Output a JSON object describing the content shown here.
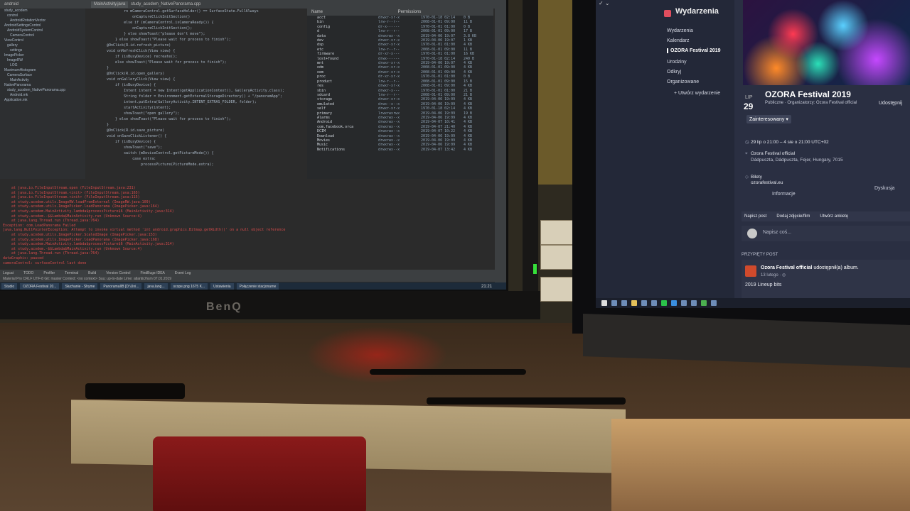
{
  "left_monitor": {
    "brand": "BenQ",
    "ide": {
      "tabs": [
        "android",
        "study_acodem_NativePanorama.cpp",
        "MainActivity.java"
      ],
      "tree": [
        "study_acodem",
        "control",
        "AndroidRotationVector",
        "AndroidSettingsControl",
        "AndroidSystemControl",
        "CameraControl",
        "ViewControl",
        "gallery",
        "settings",
        "ImagePicker",
        "ImageRW",
        "LOG",
        "MaximumHistogram",
        "CameraSurface",
        "MainActivity",
        "NativePanorama",
        "study_acodem_NativePanorama.cpp",
        "Android.mk",
        "Application.mk"
      ],
      "code": [
        "        rn mCameraControl.getSurfaceHolder() == SurfaceState.FullAlways",
        "            onCaptureClickInitSection()",
        "        else if (mCameraControl.isCameraReady()) {",
        "            onCaptureClickInitSection();",
        "        } else showToast(\"please don't move\");",
        "    } else showToast(\"Please wait for process to finish\");",
        "",
        "@OnClick(R.id.refresh_picture)",
        "void onRefreshClick(View view) {",
        "    if (isBusyDevice) recreate();",
        "    else showToast(\"Please wait for process to finish\");",
        "}",
        "",
        "@OnClick(R.id.open_gallery)",
        "void onGalleryClick(View view) {",
        "    if (isBusyDevice) {",
        "        Intent intent = new Intent(getApplicationContext(), GalleryActivity.class);",
        "        String folder = Environment.getExternalStorageDirectory() + \"/panoramApp\";",
        "        intent.putExtra(GalleryActivity.INTENT_EXTRAS_FOLDER, folder);",
        "        startActivity(intent);",
        "        showToast(\"open gallery\");",
        "    } else showToast(\"Please wait for process to finish\");",
        "}",
        "",
        "@OnClick(R.id.save_picture)",
        "void onSaveClickListener() {",
        "    if (isBusyDevice) {",
        "        showToast(\"save\");",
        "        switch (mDeviceControl.getPictureMode()) {",
        "            case extra:",
        "                processPicture(PictureMode.extra);"
      ],
      "files_header": {
        "name": "Name",
        "permissions": "Permissions"
      },
      "files": [
        {
          "name": "acct",
          "perm": "drwxr-xr-x",
          "date": "1970-01-18 02:14",
          "size": "0 B"
        },
        {
          "name": "bin",
          "perm": "lrw-r--r--",
          "date": "2008-01-01 09:00",
          "size": "11 B"
        },
        {
          "name": "config",
          "perm": "dr-x------",
          "date": "1970-01-01 01:00",
          "size": "0 B"
        },
        {
          "name": "d",
          "perm": "lrw-r--r--",
          "date": "2008-01-01 09:00",
          "size": "17 B"
        },
        {
          "name": "data",
          "perm": "drwxrwx--x",
          "date": "2019-04-06 19:07",
          "size": "3.8 KB"
        },
        {
          "name": "dev",
          "perm": "drwxr-xr-x",
          "date": "2019-04-06 19:07",
          "size": "1 KB"
        },
        {
          "name": "dsp",
          "perm": "drwxr-xr-x",
          "date": "1970-01-01 01:00",
          "size": "4 KB"
        },
        {
          "name": "etc",
          "perm": "lrw-r--r--",
          "date": "2008-01-01 09:00",
          "size": "11 B"
        },
        {
          "name": "firmware",
          "perm": "dr-xr-x---",
          "date": "1970-01-01 01:00",
          "size": "16 KB"
        },
        {
          "name": "lost+found",
          "perm": "drwx------",
          "date": "1970-01-18 02:14",
          "size": "240 B"
        },
        {
          "name": "mnt",
          "perm": "drwxr-xr-x",
          "date": "2019-04-06 19:07",
          "size": "4 KB"
        },
        {
          "name": "odm",
          "perm": "drwxr-xr-x",
          "date": "2008-01-01 09:00",
          "size": "4 KB"
        },
        {
          "name": "oem",
          "perm": "drwxr-xr-x",
          "date": "2008-01-01 09:00",
          "size": "4 KB"
        },
        {
          "name": "proc",
          "perm": "dr-xr-xr-x",
          "date": "1970-01-01 01:00",
          "size": "0 B"
        },
        {
          "name": "product",
          "perm": "lrw-r--r--",
          "date": "2008-01-01 09:00",
          "size": "15 B"
        },
        {
          "name": "res",
          "perm": "drwxr-xr-x",
          "date": "2008-01-01 09:00",
          "size": "4 KB"
        },
        {
          "name": "sbin",
          "perm": "drwxr-x---",
          "date": "1970-01-01 01:00",
          "size": "21 B"
        },
        {
          "name": "sdcard",
          "perm": "lrw-r--r--",
          "date": "2008-01-01 09:00",
          "size": "21 B"
        },
        {
          "name": "storage",
          "perm": "drwxr-xr-x",
          "date": "2019-04-06 19:09",
          "size": "4 KB"
        },
        {
          "name": "emulated",
          "perm": "drwx--x--x",
          "date": "2019-04-06 19:09",
          "size": "4 KB"
        },
        {
          "name": "self",
          "perm": "drwxr-xr-x",
          "date": "1970-01-18 02:14",
          "size": "4 KB"
        },
        {
          "name": "primary",
          "perm": "lrwxrwxrwx",
          "date": "2019-04-06 19:09",
          "size": "19 B"
        },
        {
          "name": "Alarms",
          "perm": "drwxrwx--x",
          "date": "2019-04-06 19:09",
          "size": "4 KB"
        },
        {
          "name": "Android",
          "perm": "drwxrwx--x",
          "date": "2019-04-07 10:41",
          "size": "4 KB"
        },
        {
          "name": "com.facebook.orca",
          "perm": "drwxrwx--x",
          "date": "2019-04-07 21:40",
          "size": "4 KB"
        },
        {
          "name": "DCIM",
          "perm": "drwxrwx--x",
          "date": "2019-04-07 10:22",
          "size": "4 KB"
        },
        {
          "name": "Download",
          "perm": "drwxrwx--x",
          "date": "2019-04-06 19:09",
          "size": "4 KB"
        },
        {
          "name": "Movies",
          "perm": "drwxrwx--x",
          "date": "2019-04-06 19:09",
          "size": "4 KB"
        },
        {
          "name": "Music",
          "perm": "drwxrwx--x",
          "date": "2019-04-06 19:09",
          "size": "4 KB"
        },
        {
          "name": "Notifications",
          "perm": "drwxrwx--x",
          "date": "2019-04-07 13:42",
          "size": "4 KB"
        }
      ],
      "log": [
        "    at java.io.FileInputStream.open (FileInputStream.java:231)",
        "    at java.io.FileInputStream.<init> (FileInputStream.java:165)",
        "    at java.io.FileInputStream.<init> (FileInputStream.java:115)",
        "    at study.acodem.utils.ImageRW.loadFromExternal (ImageRW.java:109)",
        "    at study.acodem.utils.ImagePicker.loadPanorama (ImagePicker.java:164)",
        "    at study.acodem.MainActivity.lambda$processPicture$6 (MainActivity.java:314)",
        "    at study.acodem.-$$Lambda$MainActivity.run (Unknown Source:4)",
        "    at java.lang.Thread.run (Thread.java:764)",
        "Exception: com.LoadPanorama Failed",
        "java.lang.NullPointerException: Attempt to invoke virtual method 'int android.graphics.Bitmap.getWidth()' on a null object reference",
        "    at study.acodem.utils.ImagePicker.ScaledImage (ImagePicker.java:153)",
        "    at study.acodem.utils.ImagePicker.loadPanorama (ImagePicker.java:168)",
        "    at study.acodem.MainActivity.lambda$processPicture$6 (MainActivity.java:314)",
        "    at study.acodem.-$$Lambda$MainActivity.run (Unknown Source:4)",
        "    at java.lang.Thread.run (Thread.java:764)",
        "dataGraphic: paused",
        "cameraControl: surfaceControl last done"
      ],
      "tool_tabs": [
        "Logcat",
        "TODO",
        "Profiler",
        "Terminal",
        "Build",
        "Version Control",
        "FindBugs-IDEA",
        "Event Log"
      ],
      "status": "Material Pro   CRLF   UTF-8   Git: master   Context: <no context>   Suu: up-to-date   Lime: atlantic/hsm 07.01.2019",
      "taskbar": [
        "Studio",
        "OZORA Festival 20...",
        "Słuchanie - Shyme",
        "PanoramaIIB [D:\\Uni...",
        "java.lang...",
        "scope.png 1675 K...",
        "Ustawienia",
        "Połączenie stacjonarne"
      ],
      "clock": "21:21"
    }
  },
  "right_monitor": {
    "sidebar": {
      "title": "Wydarzenia",
      "items": [
        "Wydarzenia",
        "Kalendarz",
        "OZORA Festival 2019",
        "Urodziny",
        "Odkryj",
        "Organizowane",
        "+ Utwórz wydarzenie"
      ]
    },
    "event": {
      "month": "LIP",
      "day": "29",
      "title": "OZORA Festival 2019",
      "subtitle": "Publiczne · Organizatorzy: Ozora Festival official",
      "share": "Udostępnij",
      "interested": "Zainteresowany ▾",
      "when": "29 lip o 21:00 – 4 sie o 21:00 UTC+02",
      "where_name": "Ozora Festival official",
      "where_addr": "Dádpuszta, Dádpuszta, Fejer, Hungary, 7015",
      "tickets_label": "Bilety",
      "tickets_url": "ozorafestival.eu",
      "tab_info": "Informacje",
      "tab_discussion": "Dyskusja"
    },
    "actions": [
      "Napisz post",
      "Dodaj zdjęcie/film",
      "Utwórz ankietę"
    ],
    "write_placeholder": "Napisz coś...",
    "pinned_header": "PRZYPIĘTY POST",
    "pinned_post": {
      "author": "Ozora Festival official",
      "verb": "udostępnił(a) album.",
      "date": "13 lutego · ◎",
      "text": "2019 Lineup bits"
    }
  }
}
